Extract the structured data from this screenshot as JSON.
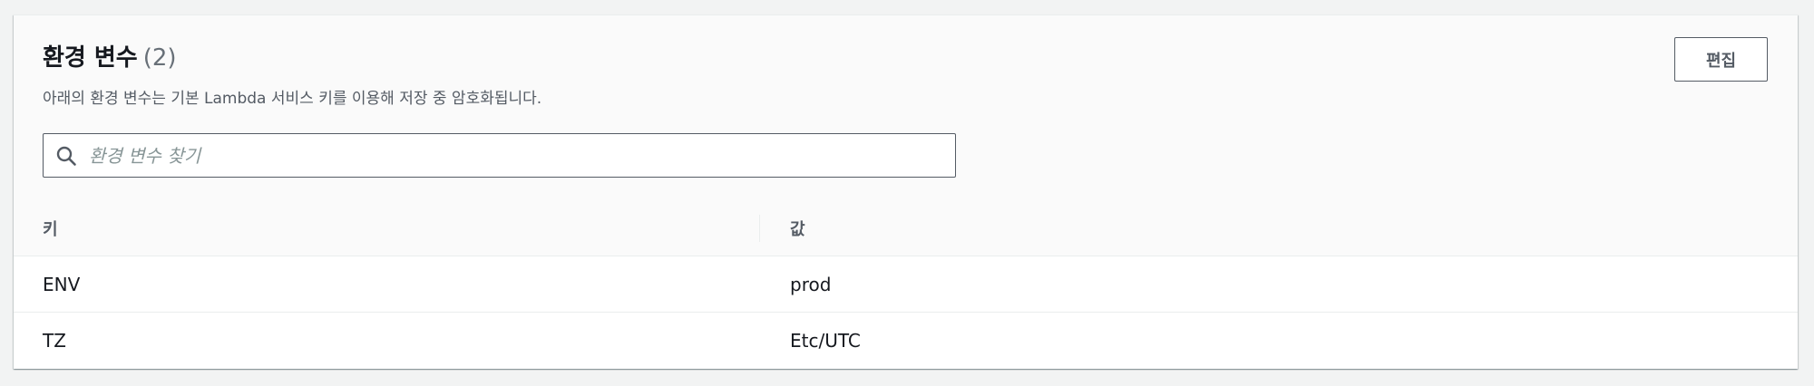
{
  "header": {
    "title": "환경 변수",
    "count": "(2)",
    "description": "아래의 환경 변수는 기본 Lambda 서비스 키를 이용해 저장 중 암호화됩니다.",
    "edit_label": "편집"
  },
  "search": {
    "placeholder": "환경 변수 찾기",
    "value": "",
    "icon": "search-icon"
  },
  "table": {
    "columns": [
      "키",
      "값"
    ],
    "rows": [
      {
        "key": "ENV",
        "value": "prod"
      },
      {
        "key": "TZ",
        "value": "Etc/UTC"
      }
    ]
  },
  "colors": {
    "background": "#f2f3f3",
    "panel": "#ffffff",
    "header_bg": "#fafafa",
    "text_primary": "#16191f",
    "text_secondary": "#545b64",
    "placeholder": "#879596",
    "border": "#eaeded"
  }
}
